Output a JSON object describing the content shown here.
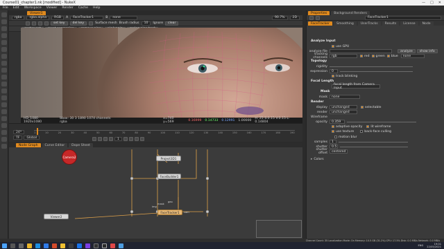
{
  "window": {
    "title": "Course01_chapter1.nk [modified] - NukeX",
    "controls": [
      "—",
      "□",
      "✕"
    ]
  },
  "menubar": [
    "File",
    "Edit",
    "Workspace",
    "Viewer",
    "Render",
    "Cache",
    "Help"
  ],
  "viewer": {
    "tab_label": "Viewer1",
    "toolbar1": {
      "channels": "rgba",
      "layer": "rgba.alpha",
      "colorspace": "RGB",
      "input_a": "A",
      "input_a_value": "FaceTracker1",
      "input_b": "B",
      "input_b_value": "none",
      "zoom": "90.7%",
      "view": "2D"
    },
    "toolbar2": {
      "b_center": "center pnt",
      "b_reset": "reset expression",
      "b_remove": "remove pins",
      "b_pin": "pin/unpin",
      "b_setkey": "set key",
      "b_delkey": "del key",
      "b_surface": "Surface mesh",
      "b_brush": "Brush radius",
      "brush_val": "10",
      "b_ignore": "Ignore",
      "b_clear": "clear"
    },
    "toolbar3": {
      "b_spring": "spring pins back"
    },
    "info": {
      "format": "HD_1080 1920x1080",
      "bbox": "bbox: 30 3 1890 1074 channels: rgba",
      "coords": "x=740 y=569",
      "r": "0.16999",
      "g": "0.14733",
      "b": "0.12991",
      "a": "1.00000",
      "h": "H: 25 S:0.15 V:0.15 L: 0.14804"
    },
    "timeline": {
      "fps_label": "24*",
      "tf_label": "TF",
      "mode": "Global",
      "ticks": [
        "1",
        "10",
        "20",
        "30",
        "40",
        "50",
        "60",
        "70",
        "80",
        "90",
        "100",
        "110",
        "120",
        "130",
        "140",
        "150",
        "160",
        "170",
        "180",
        "190"
      ],
      "frame": "1"
    }
  },
  "nodegraph": {
    "tabs": [
      "Node Graph",
      "Curve Editor",
      "Dope Sheet"
    ],
    "nodes": {
      "camera": "Camera2",
      "project": "Project3D1",
      "facebuilder": "FaceBuilder1",
      "facetracker": "FaceTracker1",
      "viewer": "Viewer2"
    },
    "wire_labels": {
      "img": "img",
      "cam": "cam",
      "geo": "geo",
      "mask": "mask"
    }
  },
  "properties": {
    "tabs": [
      "Properties",
      "Background Renders"
    ],
    "node_name": "FaceTracker1",
    "subtabs": [
      "FaceTracker",
      "Smoothing",
      "UserTracks",
      "Results",
      "License",
      "Node"
    ],
    "analyze_input": "Analyze Input",
    "use_gpu": "use GPU",
    "analyze_file": "analyze file",
    "analyze_btn": "analyze",
    "show_info": "show info",
    "tracking_channels_label": "tracking channels",
    "tracking_channels_val": "rgb",
    "chk_red": "red",
    "chk_green": "green",
    "chk_blue": "blue",
    "blue_val": "none",
    "topology": "Topology",
    "rigidity": "rigidity",
    "expression": "expression",
    "expression_val": "0",
    "track_blinking": "track blinking",
    "focal_length": "Focal Length",
    "focal_val": "focal length from Camera Input",
    "mask_title": "Mask",
    "mask_label": "mask",
    "mask_val": "none",
    "render_title": "Render",
    "display_label": "display",
    "display_val": "unchanged",
    "selectable": "selectable",
    "render_label": "render",
    "render_val": "unchanged",
    "wireframe": "Wireframe",
    "opacity_label": "opacity",
    "opacity_val": "0.359",
    "adaptive": "adaptive opacity",
    "lit": "lit wireframe",
    "use_texture": "use texture",
    "backface": "back-face culling",
    "motion_blur": "motion blur",
    "samples_label": "samples",
    "samples_val": "1",
    "shutter_label": "shutter",
    "shutter_val": "0.5",
    "offset_label": "shutter offset",
    "offset_val": "centered",
    "colors_label": "Colors"
  },
  "statusbar": "Channel Count: 35  Localization Mode: On  Memory: 10.5 GB (31.2%)  CPU: 17.5%  Disk: 0.0 MB/s  Network: 0.0 MB/s",
  "taskbar": {
    "time": "19:01",
    "date": "22/05/2021",
    "lang": "ENG"
  },
  "colors": {
    "accent": "#e08a1e",
    "camera": "#c62828",
    "wire": "#e0a24a"
  }
}
